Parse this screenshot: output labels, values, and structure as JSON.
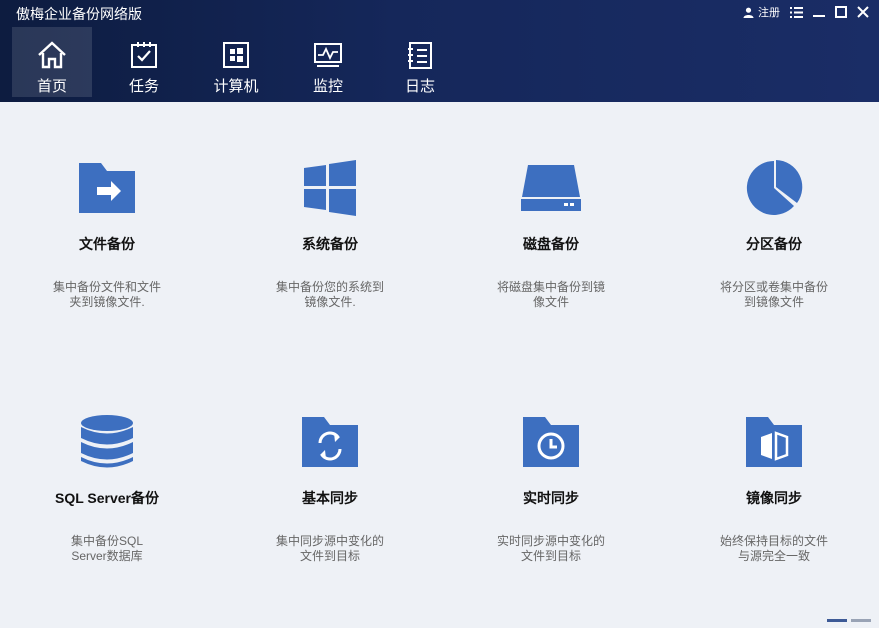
{
  "app_title": "傲梅企业备份网络版",
  "window_controls": {
    "register_label": "注册"
  },
  "nav": [
    {
      "key": "home",
      "label": "首页",
      "icon": "home-icon"
    },
    {
      "key": "tasks",
      "label": "任务",
      "icon": "task-icon"
    },
    {
      "key": "computers",
      "label": "计算机",
      "icon": "computer-icon"
    },
    {
      "key": "monitor",
      "label": "监控",
      "icon": "monitor-icon"
    },
    {
      "key": "log",
      "label": "日志",
      "icon": "log-icon"
    }
  ],
  "active_nav": "home",
  "cards": [
    {
      "title": "文件备份",
      "desc": "集中备份文件和文件夹到镜像文件.",
      "icon": "folder-arrow-icon"
    },
    {
      "title": "系统备份",
      "desc": "集中备份您的系统到镜像文件.",
      "icon": "windows-icon"
    },
    {
      "title": "磁盘备份",
      "desc": "将磁盘集中备份到镜像文件",
      "icon": "disk-icon"
    },
    {
      "title": "分区备份",
      "desc": "将分区或卷集中备份到镜像文件",
      "icon": "pie-icon"
    },
    {
      "title": "SQL Server备份",
      "desc": "集中备份SQL Server数据库",
      "icon": "database-icon"
    },
    {
      "title": "基本同步",
      "desc": "集中同步源中变化的文件到目标",
      "icon": "folder-sync-icon"
    },
    {
      "title": "实时同步",
      "desc": "实时同步源中变化的文件到目标",
      "icon": "folder-clock-icon"
    },
    {
      "title": "镜像同步",
      "desc": "始终保持目标的文件与源完全一致",
      "icon": "folder-mirror-icon"
    }
  ],
  "colors": {
    "accent": "#3d6fc0",
    "header": "#15275a"
  },
  "pager": {
    "pages": 2,
    "current": 1
  }
}
